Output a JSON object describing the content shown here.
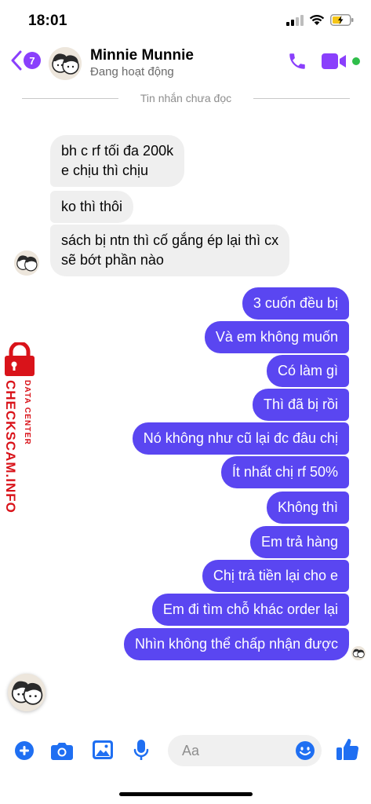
{
  "status_bar": {
    "time": "18:01"
  },
  "header": {
    "back_count": "7",
    "contact_name": "Minnie Munnie",
    "activity_status": "Đang hoạt động"
  },
  "divider_text": "Tin nhắn chưa đọc",
  "incoming_messages": [
    {
      "line1": "bh c rf tối đa 200k",
      "line2": "e chịu thì chịu"
    },
    {
      "line1": "ko thì thôi"
    },
    {
      "line1": "sách bị ntn thì cố gắng ép lại thì cx",
      "line2": "sẽ bớt phần nào"
    }
  ],
  "outgoing_messages": [
    "3 cuốn đều bị",
    "Và em không muốn",
    "Có làm gì",
    "Thì đã bị rồi",
    "Nó không như cũ lại đc đâu chị",
    "Ít nhất chị rf 50%",
    "Không thì",
    "Em trả hàng",
    "Chị trả tiền lại cho e",
    "Em đi tìm chỗ khác order lại",
    "Nhìn không thể chấp nhận được"
  ],
  "watermark": {
    "small": "DATA CENTER",
    "big": "CHECKSCAM.INFO"
  },
  "composer": {
    "placeholder": "Aa"
  },
  "colors": {
    "accent": "#8a3ffc",
    "outgoing_bubble": "#5a46f1",
    "incoming_bubble": "#efefef",
    "composer_icon": "#1f6ff2",
    "online": "#2fbe4a",
    "watermark": "#d9131a"
  },
  "icons": [
    "cellular-signal-icon",
    "wifi-icon",
    "battery-charging-icon",
    "back-chevron-icon",
    "phone-call-icon",
    "video-call-icon",
    "plus-icon",
    "camera-icon",
    "image-icon",
    "microphone-icon",
    "emoji-icon",
    "thumbs-up-icon",
    "lock-icon"
  ]
}
